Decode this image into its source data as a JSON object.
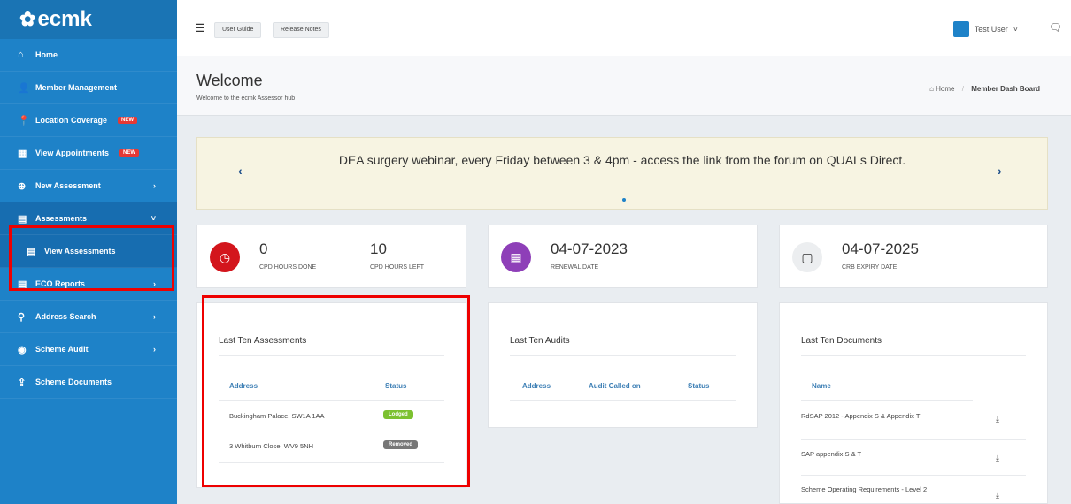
{
  "app": {
    "logo": "ecmk"
  },
  "sidebar": {
    "items": [
      {
        "label": "Home",
        "icon": "home-icon",
        "glyph": "⌂"
      },
      {
        "label": "Member Management",
        "icon": "user-icon",
        "glyph": "👤"
      },
      {
        "label": "Location Coverage",
        "icon": "map-marker-icon",
        "glyph": "📍",
        "badge": "NEW"
      },
      {
        "label": "View Appointments",
        "icon": "calendar-icon",
        "glyph": "▦",
        "badge": "NEW"
      },
      {
        "label": "New Assessment",
        "icon": "plus-circle-icon",
        "glyph": "⊕",
        "chevron": "›"
      },
      {
        "label": "Assessments",
        "icon": "file-icon",
        "glyph": "▤",
        "chevron": "˅"
      },
      {
        "label": "View Assessments",
        "icon": "file-icon",
        "glyph": "▤"
      },
      {
        "label": "ECO Reports",
        "icon": "file-icon",
        "glyph": "▤",
        "chevron": "›"
      },
      {
        "label": "Address Search",
        "icon": "search-icon",
        "glyph": "⚲",
        "chevron": "›"
      },
      {
        "label": "Scheme Audit",
        "icon": "eye-icon",
        "glyph": "◉",
        "chevron": "›"
      },
      {
        "label": "Scheme Documents",
        "icon": "upload-icon",
        "glyph": "⇪"
      }
    ]
  },
  "topbar": {
    "user_guide": "User Guide",
    "release_notes": "Release Notes",
    "user_name": "Test User",
    "user_chevron": "˅"
  },
  "page": {
    "title": "Welcome",
    "subtitle": "Welcome to the ecmk Assessor hub",
    "breadcrumb_home": "Home",
    "breadcrumb_sep": "/",
    "breadcrumb_current": "Member Dash Board"
  },
  "banner": {
    "text": "DEA surgery webinar, every Friday between 3 & 4pm - access the link from the forum on QUALs Direct.",
    "prev": "‹",
    "next": "›"
  },
  "stats": {
    "cpd_done_value": "0",
    "cpd_done_label": "CPD HOURS DONE",
    "cpd_left_value": "10",
    "cpd_left_label": "CPD HOURS LEFT",
    "renewal_value": "04-07-2023",
    "renewal_label": "RENEWAL DATE",
    "crb_value": "04-07-2025",
    "crb_label": "CRB EXPIRY DATE",
    "colors": {
      "cpd": "#d3151c",
      "renewal": "#8e3fb8",
      "crb": "#eceef0"
    }
  },
  "assessments": {
    "title": "Last Ten Assessments",
    "col_address": "Address",
    "col_status": "Status",
    "rows": [
      {
        "address": "Buckingham Palace, SW1A 1AA",
        "status": "Lodged",
        "color": "#7cc130"
      },
      {
        "address": "3 Whitburn Close, WV9 5NH",
        "status": "Removed",
        "color": "#777777"
      }
    ]
  },
  "audits": {
    "title": "Last Ten Audits",
    "col_address": "Address",
    "col_called": "Audit Called on",
    "col_status": "Status"
  },
  "documents": {
    "title": "Last Ten Documents",
    "col_name": "Name",
    "rows": [
      {
        "name": "RdSAP 2012 - Appendix S & Appendix T"
      },
      {
        "name": "SAP appendix S & T"
      },
      {
        "name": "Scheme Operating Requirements - Level 2"
      }
    ]
  }
}
